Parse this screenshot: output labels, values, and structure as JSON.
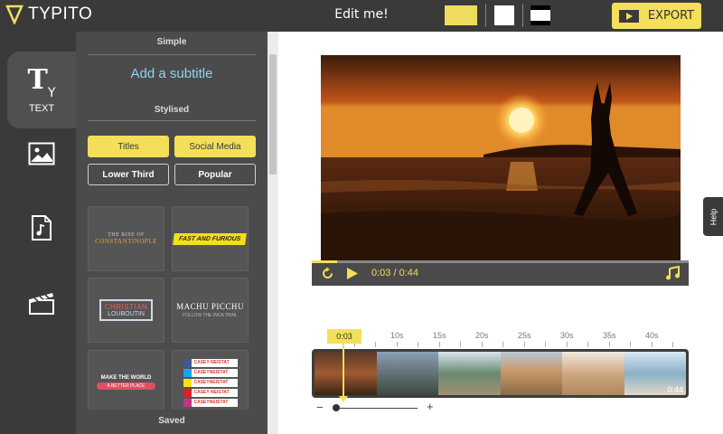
{
  "app": {
    "logo_text": "TYPITO",
    "title": "Edit me!"
  },
  "colors": {
    "accent": "#f3df5a",
    "dark": "#3a3a3a",
    "panel": "#4b4b4b",
    "link": "#8fd3f0"
  },
  "toolbar": {
    "swatches": [
      "yellow",
      "white",
      "black-white"
    ],
    "export_label": "EXPORT",
    "export_icon": "film-play-icon"
  },
  "nav": {
    "items": [
      {
        "label": "TEXT",
        "icon": "text-icon",
        "active": true
      },
      {
        "label": "",
        "icon": "image-icon",
        "active": false
      },
      {
        "label": "",
        "icon": "music-file-icon",
        "active": false
      },
      {
        "label": "",
        "icon": "clapperboard-icon",
        "active": false
      }
    ]
  },
  "panel": {
    "simple_title": "Simple",
    "add_subtitle": "Add a subtitle",
    "stylised_title": "Stylised",
    "categories": [
      "Titles",
      "Social Media",
      "Lower Third",
      "Popular"
    ],
    "thumbnails": {
      "t1_line1": "THE RISE OF",
      "t1_line2": "CONSTANTINOPLE",
      "t2": "FAST AND FURIOUS",
      "t3_line1": "CHRISTIAN",
      "t3_line2": "LOUBOUTIN",
      "t4_line1": "MACHU PICCHU",
      "t4_line2": "FOLLOW THE INCA TRAIL",
      "t5_line1": "MAKE THE WORLD",
      "t5_line2": "A BETTER PLACE",
      "social_handles": [
        "CASEY NEISTAT",
        "CASEYNEISTAT",
        "CASEYNEISTAT",
        "CASEY NEISTAT",
        "CASEYNEISTAT"
      ]
    },
    "saved_title": "Saved"
  },
  "player": {
    "current_time": "0:03",
    "separator": "/",
    "duration": "0:44",
    "progress": 0.068
  },
  "help_label": "Help",
  "timeline": {
    "marker": "0:03",
    "ticks": [
      "10s",
      "15s",
      "20s",
      "25s",
      "30s",
      "35s",
      "40s"
    ],
    "strip_duration": "0:44",
    "zoom_minus": "−",
    "zoom_plus": "+"
  }
}
